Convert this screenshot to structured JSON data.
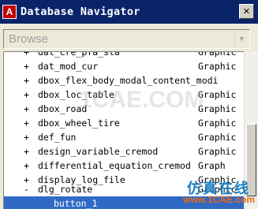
{
  "window": {
    "title": "Database Navigator",
    "app_icon": "A",
    "close_label": "✕"
  },
  "browse": {
    "value": "Browse",
    "arrow": "▼"
  },
  "list": {
    "items": [
      {
        "pm": "+",
        "name": "dat_cre_pfa_sta",
        "type": "Graphic"
      },
      {
        "pm": "+",
        "name": "dat_mod_cur",
        "type": "Graphic"
      },
      {
        "pm": "+",
        "name": "dbox_flex_body_modal_content_modi",
        "type": ""
      },
      {
        "pm": "+",
        "name": "dbox_loc_table",
        "type": "Graphic"
      },
      {
        "pm": "+",
        "name": "dbox_road",
        "type": "Graphic"
      },
      {
        "pm": "+",
        "name": "dbox_wheel_tire",
        "type": "Graphic"
      },
      {
        "pm": "+",
        "name": "def_fun",
        "type": "Graphic"
      },
      {
        "pm": "+",
        "name": "design_variable_cremod",
        "type": "Graphic"
      },
      {
        "pm": "+",
        "name": "differential_equation_cremod",
        "type": "Graph"
      },
      {
        "pm": "+",
        "name": "display_log_file",
        "type": "Graphic"
      },
      {
        "pm": "-",
        "name": "dlg_rotate",
        "type": "Graphic"
      },
      {
        "pm": "",
        "name": "button_1",
        "type": "",
        "selected": true
      }
    ]
  },
  "watermark": "1CAE.COM",
  "logo": {
    "cn_text": "仿真在线",
    "url_text": "www.1CAE.com"
  }
}
